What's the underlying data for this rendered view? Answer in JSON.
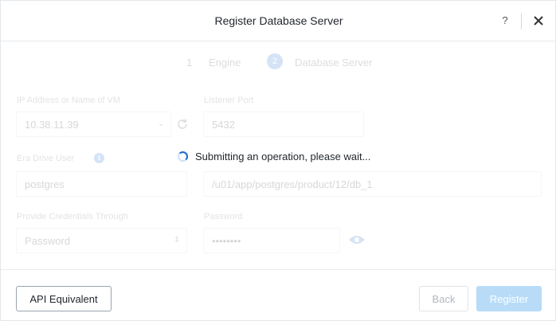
{
  "dialog": {
    "title": "Register Database Server",
    "help_label": "?"
  },
  "steps": [
    {
      "number": "1",
      "label": "Engine"
    },
    {
      "number": "2",
      "label": "Database Server"
    }
  ],
  "form": {
    "ip_label": "IP Address or Name of VM",
    "ip_value": "10.38.11.39",
    "port_label": "Listener Port",
    "port_value": "5432",
    "drive_user_label": "Era Drive User",
    "drive_user_value": "postgres",
    "software_home_value": "/u01/app/postgres/product/12/db_1",
    "credentials_label": "Provide Credentials Through",
    "credentials_value": "Password",
    "password_label": "Password",
    "password_value": "••••••••"
  },
  "overlay": {
    "message": "Submitting an operation, please wait..."
  },
  "footer": {
    "api_label": "API Equivalent",
    "back_label": "Back",
    "register_label": "Register"
  },
  "colors": {
    "accent": "#1b6ad0",
    "register_disabled": "#b8dcf8"
  }
}
